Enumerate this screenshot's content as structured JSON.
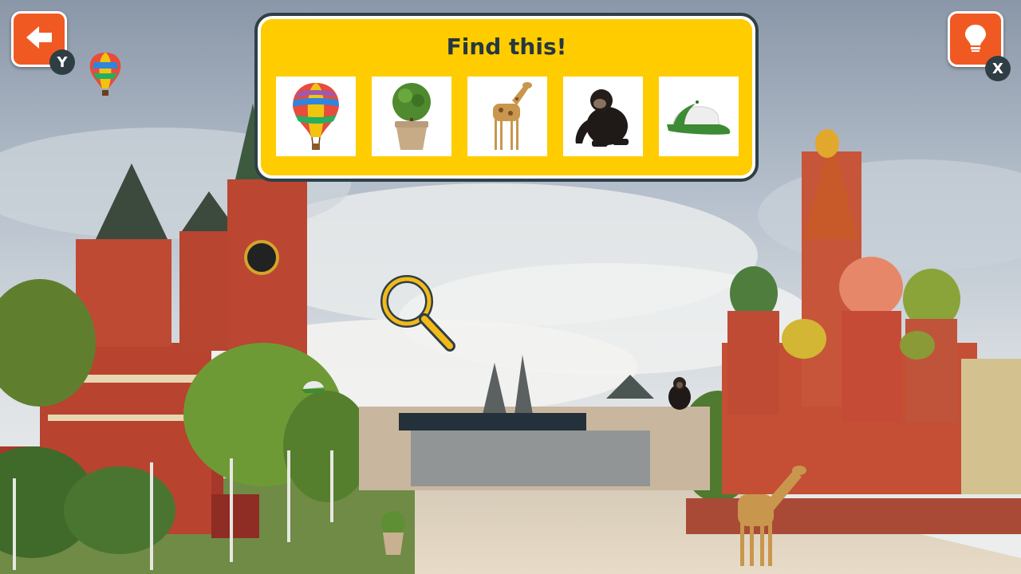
{
  "panel": {
    "title": "Find this!"
  },
  "targets": [
    {
      "name": "hot-air-balloon"
    },
    {
      "name": "potted-plant"
    },
    {
      "name": "giraffe"
    },
    {
      "name": "chimpanzee"
    },
    {
      "name": "baseball-cap"
    }
  ],
  "controls": {
    "back_key": "Y",
    "hint_key": "X",
    "back_icon": "arrow-left-icon",
    "hint_icon": "lightbulb-icon"
  },
  "colors": {
    "panel_fill": "#ffcc00",
    "panel_border": "#2e3f48",
    "button_orange": "#f05a22",
    "badge_dark": "#2f3e45"
  }
}
